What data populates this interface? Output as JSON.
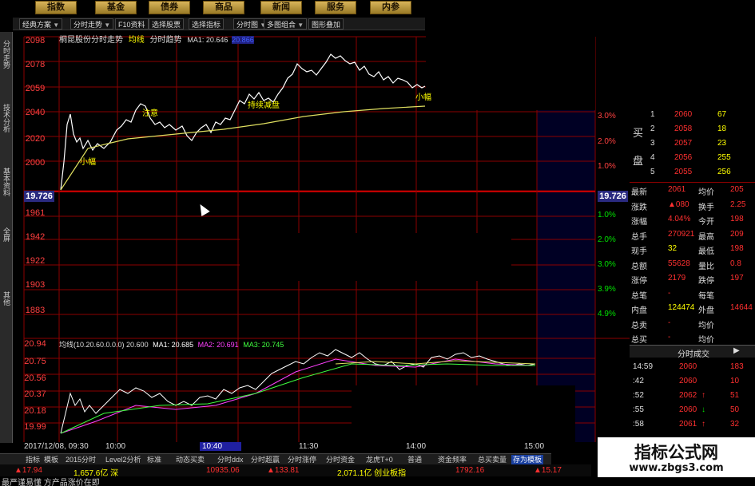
{
  "topbar": {
    "buttons": [
      "指数",
      "基金",
      "债券",
      "商品",
      "新闻",
      "服务",
      "内参"
    ]
  },
  "toolbar": {
    "tabs": [
      {
        "label": "经典方案",
        "dropdown": true
      },
      {
        "label": "分时走势",
        "dropdown": true
      },
      {
        "label": "F10资料",
        "dropdown": false
      },
      {
        "label": "选择股票",
        "dropdown": false
      },
      {
        "label": "选择指标",
        "dropdown": false
      },
      {
        "label": "分时图",
        "dropdown": true
      },
      {
        "label": "多图组合",
        "dropdown": true
      },
      {
        "label": "图形叠加",
        "dropdown": false
      }
    ]
  },
  "left_rail": [
    "分时走势",
    "技术分析",
    "基本资料",
    "全屏",
    "其他"
  ],
  "main_chart": {
    "title": "桐昆股份分时走势",
    "avg_label": "均线",
    "sub_label": "分时趋势",
    "ma_label": "MA1: 20.646",
    "ma_value": "20.866",
    "price_labels": [
      "2098",
      "2078",
      "2059",
      "2040",
      "2020",
      "2000",
      "1961",
      "1942",
      "1922",
      "1903",
      "1883"
    ],
    "mid_price": "19.726",
    "pct_labels": [
      "3.0%",
      "2.0%",
      "1.0%",
      "1.0%",
      "2.0%",
      "3.0%",
      "3.9%",
      "4.9%"
    ],
    "annotations": [
      "注意",
      "小幅",
      "持续减盘",
      "小幅"
    ]
  },
  "sub_chart": {
    "header": "均线(10.20.60.0.0.0) 20.600",
    "ma1": "MA1: 20.685",
    "ma2": "MA2: 20.691",
    "ma3": "MA3: 20.745",
    "y_labels": [
      "20.94",
      "20.75",
      "20.56",
      "20.37",
      "20.18",
      "19.99"
    ]
  },
  "time_axis": {
    "start": "2017/12/08, 09:30",
    "ticks": [
      "10:00",
      "10:40",
      "11:30",
      "14:00",
      "15:00"
    ]
  },
  "order_book": {
    "buy_label": "买",
    "pan_label": "盘",
    "rows": [
      {
        "n": "1",
        "price": "2060",
        "vol": "67"
      },
      {
        "n": "2",
        "price": "2058",
        "vol": "18"
      },
      {
        "n": "3",
        "price": "2057",
        "vol": "23"
      },
      {
        "n": "4",
        "price": "2056",
        "vol": "255"
      },
      {
        "n": "5",
        "price": "2055",
        "vol": "256"
      }
    ]
  },
  "quote": {
    "rows": [
      {
        "l1": "最新",
        "v1": "2061",
        "l2": "均价",
        "v2": "205"
      },
      {
        "l1": "涨跌",
        "v1": "▲080",
        "l2": "换手",
        "v2": "2.25"
      },
      {
        "l1": "涨幅",
        "v1": "4.04%",
        "l2": "今开",
        "v2": "198"
      },
      {
        "l1": "总手",
        "v1": "270921",
        "l2": "最高",
        "v2": "209"
      },
      {
        "l1": "现手",
        "v1": "32",
        "l2": "最低",
        "v2": "198"
      },
      {
        "l1": "总额",
        "v1": "55628",
        "l2": "量比",
        "v2": "0.8"
      },
      {
        "l1": "涨停",
        "v1": "2179",
        "l2": "跌停",
        "v2": "197"
      },
      {
        "l1": "总笔",
        "v1": "-",
        "l2": "每笔",
        "v2": ""
      },
      {
        "l1": "内盘",
        "v1": "124474",
        "l2": "外盘",
        "v2": "14644"
      },
      {
        "l1": "总卖",
        "v1": "-",
        "l2": "均价",
        "v2": ""
      },
      {
        "l1": "总买",
        "v1": "-",
        "l2": "均价",
        "v2": ""
      }
    ]
  },
  "trades": {
    "header": "分时成交",
    "rows": [
      {
        "t": "14:59",
        "p": "2060",
        "v": "183",
        "dir": ""
      },
      {
        "t": ":42",
        "p": "2060",
        "v": "10",
        "dir": ""
      },
      {
        "t": ":52",
        "p": "2062",
        "v": "51",
        "dir": "up"
      },
      {
        "t": ":55",
        "p": "2060",
        "v": "50",
        "dir": "down"
      },
      {
        "t": ":58",
        "p": "2061",
        "v": "32",
        "dir": "up"
      }
    ]
  },
  "bottom_tabs": [
    "指标",
    "模板",
    "2015分时",
    "Level2分析",
    "标准",
    "动态买卖",
    "分时ddx",
    "分时超赢",
    "分时涨停",
    "分时资金",
    "龙虎T+0",
    "普通",
    "资金频率",
    "总买卖量",
    "存为模板"
  ],
  "status": {
    "a": "▲17.94",
    "b": "1,657.6亿 深",
    "c": "10935.06",
    "d": "▲133.81",
    "e": "2,071.1亿 创业板指",
    "f": "1792.16",
    "g": "▲15.17"
  },
  "ticker_text": "最严谨易懂 方产品涨价在即",
  "watermark": {
    "line1": "指标公式网",
    "line2": "www.zbgs3.com"
  },
  "colors": {
    "up": "#ff3030",
    "down": "#00e000",
    "price_line": "#ffffff",
    "avg_line": "#e0e060",
    "grid": "#8b0000",
    "label": "#ff4040",
    "blue": "#4060ff",
    "yellow": "#ffff00"
  }
}
